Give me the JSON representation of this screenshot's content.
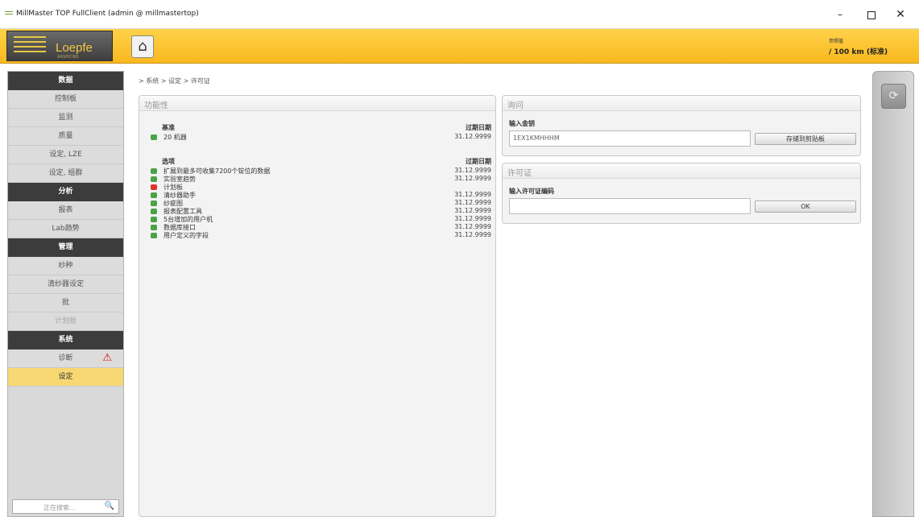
{
  "window": {
    "title": "MillMaster TOP FullClient (admin @ millmastertop)",
    "min_glyph": "–",
    "close_glyph": "✕"
  },
  "header": {
    "logo_text": "Loepfe",
    "logo_sub": "AASPICINS",
    "home_icon": "⌂",
    "ref_label": "参照值",
    "ref_value": "/ 100 km (标准)"
  },
  "sidebar": {
    "sections": [
      {
        "title": "数据",
        "items": [
          {
            "label": "控制板",
            "state": "normal"
          },
          {
            "label": "监测",
            "state": "normal"
          },
          {
            "label": "质量",
            "state": "normal"
          },
          {
            "label": "设定, LZE",
            "state": "normal"
          },
          {
            "label": "设定, 组群",
            "state": "normal"
          }
        ]
      },
      {
        "title": "分析",
        "items": [
          {
            "label": "报表",
            "state": "normal"
          },
          {
            "label": "Lab趋势",
            "state": "normal"
          }
        ]
      },
      {
        "title": "管理",
        "items": [
          {
            "label": "纱种",
            "state": "normal"
          },
          {
            "label": "清纱器设定",
            "state": "normal"
          },
          {
            "label": "批",
            "state": "normal"
          },
          {
            "label": "计划板",
            "state": "disabled"
          }
        ]
      },
      {
        "title": "系统",
        "items": [
          {
            "label": "诊断",
            "state": "warning"
          },
          {
            "label": "设定",
            "state": "active"
          }
        ]
      }
    ],
    "search_placeholder": "正在搜索...",
    "search_icon": "🔍",
    "warning_icon": "⚠"
  },
  "breadcrumb": "> 系统 > 设定 > 许可证",
  "functionality": {
    "title": "功能性",
    "base": {
      "header": "基准",
      "expiry_label": "过期日期",
      "items": [
        {
          "name": "20 机器",
          "date": "31.12.9999",
          "status": "green"
        }
      ]
    },
    "options": {
      "header": "选项",
      "expiry_label": "过期日期",
      "items": [
        {
          "name": "扩展到最多可收集7200个锭位的数据",
          "date": "31.12.9999",
          "status": "green"
        },
        {
          "name": "实验室趋势",
          "date": "31.12.9999",
          "status": "green"
        },
        {
          "name": "计划板",
          "date": "",
          "status": "red"
        },
        {
          "name": "清纱器助手",
          "date": "31.12.9999",
          "status": "green"
        },
        {
          "name": "纱疵图",
          "date": "31.12.9999",
          "status": "green"
        },
        {
          "name": "报表配置工具",
          "date": "31.12.9999",
          "status": "green"
        },
        {
          "name": "5台增加的用户机",
          "date": "31.12.9999",
          "status": "green"
        },
        {
          "name": "数据库接口",
          "date": "31.12.9999",
          "status": "green"
        },
        {
          "name": "用户定义的字段",
          "date": "31.12.9999",
          "status": "green"
        }
      ]
    }
  },
  "query": {
    "title": "询问",
    "label": "输入金钥",
    "value": "1EX1KMHHHM",
    "button": "存储到剪贴板"
  },
  "license": {
    "title": "许可证",
    "label": "输入许可证编码",
    "value": "",
    "button": "OK"
  },
  "rightbar": {
    "refresh_icon": "⟳"
  },
  "colors": {
    "header_yellow": "#f9b81e",
    "active_item": "#f7d873",
    "status_green": "#49a34a",
    "status_red": "#d33333",
    "warning_red": "#dd1111"
  }
}
